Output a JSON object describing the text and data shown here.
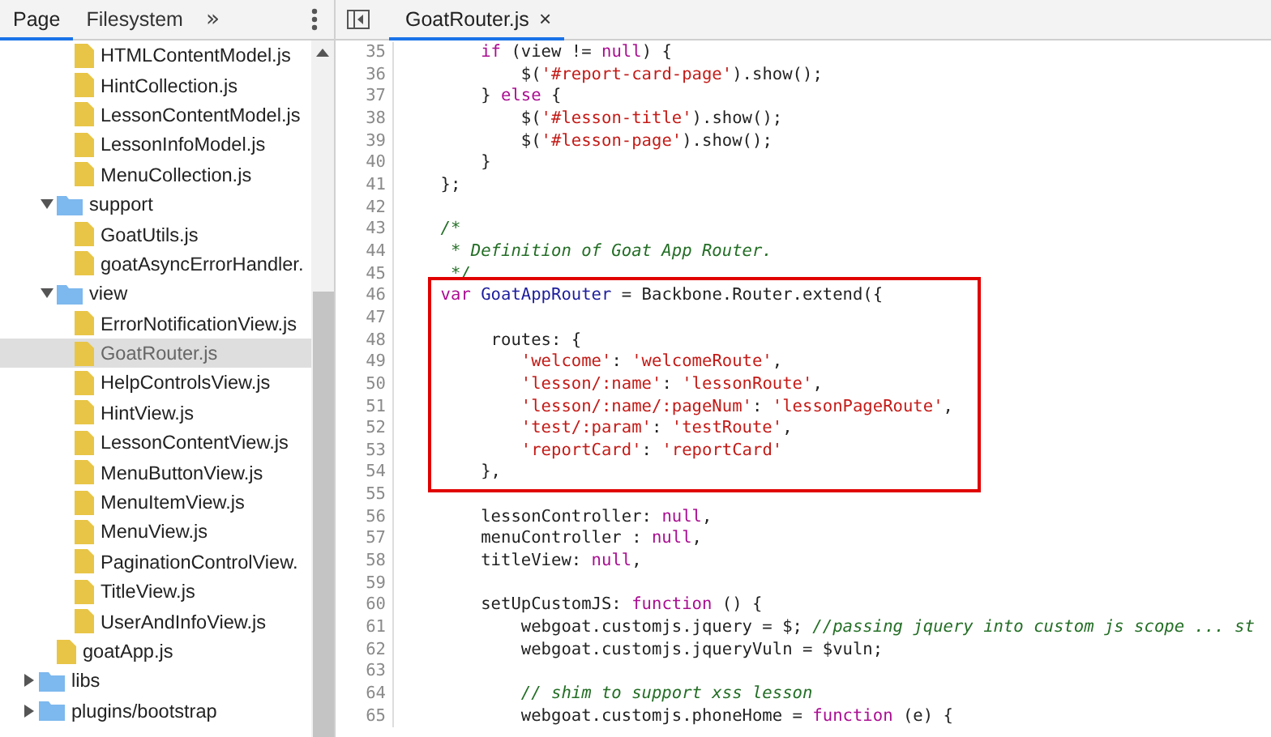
{
  "navigator": {
    "tabs": [
      {
        "label": "Page",
        "selected": true
      },
      {
        "label": "Filesystem",
        "selected": false
      }
    ],
    "more": "»"
  },
  "tree": [
    {
      "children": [
        {
          "children": [
            {
              "kind": "file",
              "name": "HTMLContentModel.js",
              "selected": false
            },
            {
              "kind": "file",
              "name": "HintCollection.js",
              "selected": false
            },
            {
              "kind": "file",
              "name": "LessonContentModel.js",
              "selected": false
            },
            {
              "kind": "file",
              "name": "LessonInfoModel.js",
              "selected": false
            },
            {
              "kind": "file",
              "name": "MenuCollection.js",
              "selected": false
            }
          ]
        },
        {
          "kind": "folder",
          "name": "support",
          "expanded": true,
          "selected": false,
          "children": [
            {
              "kind": "file",
              "name": "GoatUtils.js",
              "selected": false
            },
            {
              "kind": "file",
              "name": "goatAsyncErrorHandler.",
              "selected": false
            }
          ]
        },
        {
          "kind": "folder",
          "name": "view",
          "expanded": true,
          "selected": false,
          "children": [
            {
              "kind": "file",
              "name": "ErrorNotificationView.js",
              "selected": false
            },
            {
              "kind": "file",
              "name": "GoatRouter.js",
              "selected": true
            },
            {
              "kind": "file",
              "name": "HelpControlsView.js",
              "selected": false
            },
            {
              "kind": "file",
              "name": "HintView.js",
              "selected": false
            },
            {
              "kind": "file",
              "name": "LessonContentView.js",
              "selected": false
            },
            {
              "kind": "file",
              "name": "MenuButtonView.js",
              "selected": false
            },
            {
              "kind": "file",
              "name": "MenuItemView.js",
              "selected": false
            },
            {
              "kind": "file",
              "name": "MenuView.js",
              "selected": false
            },
            {
              "kind": "file",
              "name": "PaginationControlView.",
              "selected": false
            },
            {
              "kind": "file",
              "name": "TitleView.js",
              "selected": false
            },
            {
              "kind": "file",
              "name": "UserAndInfoView.js",
              "selected": false
            }
          ]
        },
        {
          "kind": "file",
          "name": "goatApp.js",
          "selected": false
        }
      ]
    },
    {
      "kind": "folder",
      "name": "libs",
      "expanded": false,
      "selected": false
    },
    {
      "kind": "folder",
      "name": "plugins/bootstrap",
      "expanded": false,
      "selected": false
    }
  ],
  "editor": {
    "tabs": [
      {
        "label": "GoatRouter.js",
        "selected": true
      }
    ],
    "close": "×",
    "sections": [
      {
        "highlighted": false,
        "lines": [
          {
            "number": "35",
            "tokens": [
              {
                "kind": "kw",
                "text": "        if"
              },
              {
                "kind": "plain",
                "text": " (view != "
              },
              {
                "kind": "kw",
                "text": "null"
              },
              {
                "kind": "plain",
                "text": ") {"
              }
            ]
          },
          {
            "number": "36",
            "tokens": [
              {
                "kind": "plain",
                "text": "            $("
              },
              {
                "kind": "str",
                "text": "'#report-card-page'"
              },
              {
                "kind": "plain",
                "text": ").show();"
              }
            ]
          },
          {
            "number": "37",
            "tokens": [
              {
                "kind": "plain",
                "text": "        } "
              },
              {
                "kind": "kw",
                "text": "else"
              },
              {
                "kind": "plain",
                "text": " {"
              }
            ]
          },
          {
            "number": "38",
            "tokens": [
              {
                "kind": "plain",
                "text": "            $("
              },
              {
                "kind": "str",
                "text": "'#lesson-title'"
              },
              {
                "kind": "plain",
                "text": ").show();"
              }
            ]
          },
          {
            "number": "39",
            "tokens": [
              {
                "kind": "plain",
                "text": "            $("
              },
              {
                "kind": "str",
                "text": "'#lesson-page'"
              },
              {
                "kind": "plain",
                "text": ").show();"
              }
            ]
          },
          {
            "number": "40",
            "tokens": [
              {
                "kind": "plain",
                "text": "        }"
              }
            ]
          },
          {
            "number": "41",
            "tokens": [
              {
                "kind": "plain",
                "text": "    };"
              }
            ]
          },
          {
            "number": "42"
          },
          {
            "number": "43",
            "tokens": [
              {
                "kind": "comment",
                "text": "    /*"
              }
            ]
          },
          {
            "number": "44",
            "tokens": [
              {
                "kind": "comment",
                "text": "     * Definition of Goat App Router."
              }
            ]
          },
          {
            "number": "45",
            "tokens": [
              {
                "kind": "comment",
                "text": "     */"
              }
            ]
          }
        ]
      },
      {
        "highlighted": true,
        "lines": [
          {
            "number": "46",
            "tokens": [
              {
                "kind": "kw",
                "text": "    var"
              },
              {
                "kind": "def",
                "text": " GoatAppRouter"
              },
              {
                "kind": "plain",
                "text": " = Backbone.Router.extend({"
              }
            ]
          },
          {
            "number": "47"
          },
          {
            "number": "48",
            "tokens": [
              {
                "kind": "plain",
                "text": "         routes: {"
              }
            ]
          },
          {
            "number": "49",
            "tokens": [
              {
                "kind": "str",
                "text": "            'welcome'"
              },
              {
                "kind": "plain",
                "text": ": "
              },
              {
                "kind": "str",
                "text": "'welcomeRoute'"
              },
              {
                "kind": "plain",
                "text": ","
              }
            ]
          },
          {
            "number": "50",
            "tokens": [
              {
                "kind": "str",
                "text": "            'lesson/:name'"
              },
              {
                "kind": "plain",
                "text": ": "
              },
              {
                "kind": "str",
                "text": "'lessonRoute'"
              },
              {
                "kind": "plain",
                "text": ","
              }
            ]
          },
          {
            "number": "51",
            "tokens": [
              {
                "kind": "str",
                "text": "            'lesson/:name/:pageNum'"
              },
              {
                "kind": "plain",
                "text": ": "
              },
              {
                "kind": "str",
                "text": "'lessonPageRoute'"
              },
              {
                "kind": "plain",
                "text": ","
              }
            ]
          },
          {
            "number": "52",
            "tokens": [
              {
                "kind": "str",
                "text": "            'test/:param'"
              },
              {
                "kind": "plain",
                "text": ": "
              },
              {
                "kind": "str",
                "text": "'testRoute'"
              },
              {
                "kind": "plain",
                "text": ","
              }
            ]
          },
          {
            "number": "53",
            "tokens": [
              {
                "kind": "str",
                "text": "            'reportCard'"
              },
              {
                "kind": "plain",
                "text": ": "
              },
              {
                "kind": "str",
                "text": "'reportCard'"
              }
            ]
          },
          {
            "number": "54",
            "tokens": [
              {
                "kind": "plain",
                "text": "        },"
              }
            ]
          }
        ]
      },
      {
        "highlighted": false,
        "lines": [
          {
            "number": "55"
          },
          {
            "number": "56",
            "tokens": [
              {
                "kind": "plain",
                "text": "        lessonController: "
              },
              {
                "kind": "kw",
                "text": "null"
              },
              {
                "kind": "plain",
                "text": ","
              }
            ]
          },
          {
            "number": "57",
            "tokens": [
              {
                "kind": "plain",
                "text": "        menuController : "
              },
              {
                "kind": "kw",
                "text": "null"
              },
              {
                "kind": "plain",
                "text": ","
              }
            ]
          },
          {
            "number": "58",
            "tokens": [
              {
                "kind": "plain",
                "text": "        titleView: "
              },
              {
                "kind": "kw",
                "text": "null"
              },
              {
                "kind": "plain",
                "text": ","
              }
            ]
          },
          {
            "number": "59"
          },
          {
            "number": "60",
            "tokens": [
              {
                "kind": "plain",
                "text": "        setUpCustomJS: "
              },
              {
                "kind": "kw",
                "text": "function"
              },
              {
                "kind": "plain",
                "text": " () {"
              }
            ]
          },
          {
            "number": "61",
            "tokens": [
              {
                "kind": "plain",
                "text": "            webgoat.customjs.jquery = $;"
              },
              {
                "kind": "comment",
                "text": " //passing jquery into custom js scope ... st"
              }
            ]
          },
          {
            "number": "62",
            "tokens": [
              {
                "kind": "plain",
                "text": "            webgoat.customjs.jqueryVuln = $vuln;"
              }
            ]
          },
          {
            "number": "63"
          },
          {
            "number": "64",
            "tokens": [
              {
                "kind": "comment",
                "text": "            // shim to support xss lesson"
              }
            ]
          },
          {
            "number": "65",
            "tokens": [
              {
                "kind": "plain",
                "text": "            webgoat.customjs.phoneHome = "
              },
              {
                "kind": "kw",
                "text": "function"
              },
              {
                "kind": "plain",
                "text": " (e) {"
              }
            ]
          }
        ]
      }
    ]
  }
}
